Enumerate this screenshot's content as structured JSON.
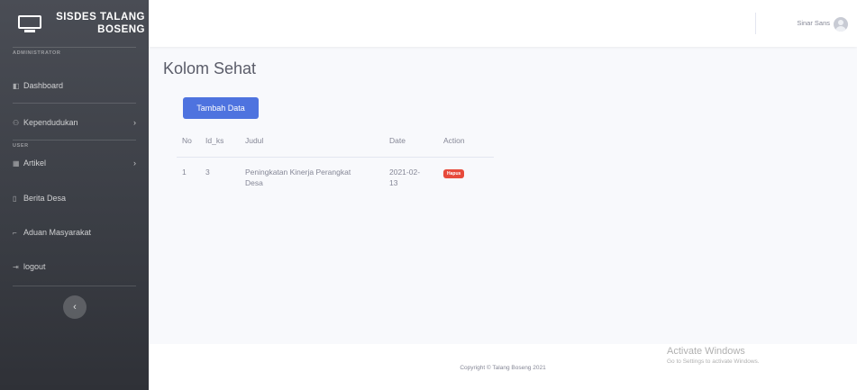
{
  "sidebar": {
    "brand_line1": "SISDES TALANG",
    "brand_line2": "BOSENG",
    "heading_admin": "ADMINISTRATOR",
    "heading_user": "USER",
    "items": [
      {
        "label": "Dashboard",
        "icon": "dashboard-icon"
      },
      {
        "label": "Kependudukan",
        "icon": "users-icon"
      },
      {
        "label": "Artikel",
        "icon": "table-icon"
      },
      {
        "label": "Berita Desa",
        "icon": "file-icon"
      },
      {
        "label": "Aduan Masyarakat",
        "icon": "message-icon"
      },
      {
        "label": "logout",
        "icon": "logout-icon"
      }
    ],
    "chevron": "›",
    "toggle": "‹"
  },
  "topbar": {
    "user_name": "Sinar Sans"
  },
  "main": {
    "title": "Kolom Sehat",
    "add_button": "Tambah Data",
    "table": {
      "headers": [
        "No",
        "Id_ks",
        "Judul",
        "Date",
        "Action"
      ],
      "rows": [
        {
          "no": "1",
          "id_ks": "3",
          "judul": "Peningkatan Kinerja Perangkat Desa",
          "date": "2021-02-13",
          "action": "Hapus"
        }
      ]
    }
  },
  "footer": {
    "copyright": "Copyright © Talang Boseng 2021"
  },
  "watermark": {
    "line1": "Activate Windows",
    "line2": "Go to Settings to activate Windows."
  },
  "colors": {
    "primary": "#4e73df",
    "danger": "#e74a3b",
    "sidebar": "#3a3d44"
  }
}
